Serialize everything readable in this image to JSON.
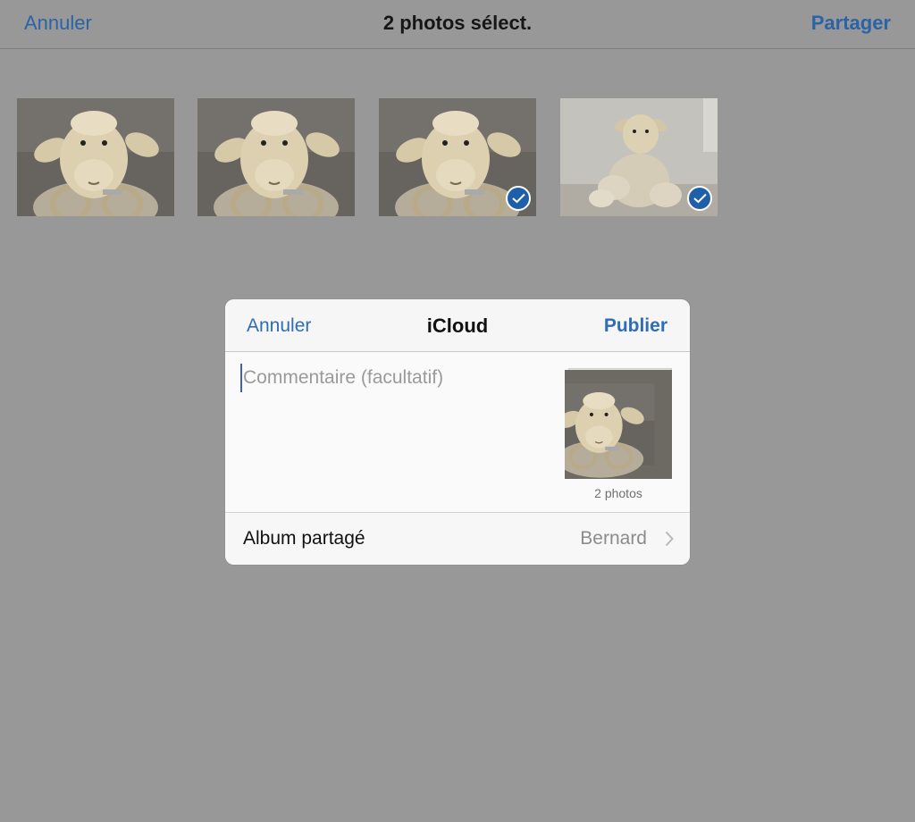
{
  "navbar": {
    "cancel_label": "Annuler",
    "title": "2 photos sélect.",
    "share_label": "Partager"
  },
  "photos": [
    {
      "selected": false
    },
    {
      "selected": false
    },
    {
      "selected": true
    },
    {
      "selected": true
    }
  ],
  "dialog": {
    "cancel_label": "Annuler",
    "title": "iCloud",
    "publish_label": "Publier",
    "comment_placeholder": "Commentaire (facultatif)",
    "photo_count_label": "2 photos",
    "album_label": "Album partagé",
    "album_value": "Bernard"
  },
  "colors": {
    "accent": "#2a63a6",
    "background_dim": "#989898",
    "checkmark_bg": "#1f5ea8"
  },
  "icons": {
    "selected": "checkmark-circle-icon",
    "disclosure": "chevron-right-icon"
  }
}
